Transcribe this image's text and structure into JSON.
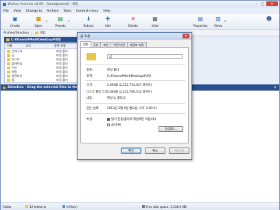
{
  "window": {
    "title": "WinAce Archiver v2.69 - [Unregistered] - 바탕"
  },
  "menu": [
    "File",
    "View",
    "Change to",
    "Archive",
    "Tools",
    "Context menu",
    "Help"
  ],
  "toolbar": {
    "create": "Create",
    "open": "Open",
    "presets": "Presets",
    "extract": "Extract",
    "add": "Add",
    "delete": "Delete",
    "view": "View",
    "properties": "Properties",
    "views": "Views"
  },
  "tabs": {
    "archive_directory": "Archive/Directory",
    "current": "바탕"
  },
  "path": "C:#Users#Mel#Desktop#바탕",
  "left_columns": {
    "name": "이름",
    "size": "크기",
    "type": "항목 유형"
  },
  "left_files": [
    {
      "name": "갓게구리",
      "size": "",
      "type": "파일 폴더"
    },
    {
      "name": "곰",
      "size": "",
      "type": "파일 폴더"
    },
    {
      "name": "마그다",
      "size": "",
      "type": "파일 폴더"
    },
    {
      "name": "플래티넘",
      "size": "",
      "type": "파일 폴더"
    },
    {
      "name": "이브",
      "size": "",
      "type": "파일 폴더"
    },
    {
      "name": "바람",
      "size": "",
      "type": "파일 폴더"
    },
    {
      "name": "발렌타인",
      "size": "",
      "type": "파일 폴더"
    },
    {
      "name": "물",
      "size": "",
      "type": "파일 폴더"
    }
  ],
  "selection_bar": "Selection - Drag the selected files to the",
  "status": {
    "panel": "Folder",
    "selection": "12 folder(s)",
    "files": "0 file(s)",
    "disk": "Free disk space: 1,336.6 MB"
  },
  "dialog": {
    "title": "곰 속성",
    "tabs": [
      "일반",
      "공유",
      "보안",
      "이전 버전",
      "사용자 지정"
    ],
    "name_value": "곰",
    "rows": [
      {
        "label": "종류:",
        "value": "파일 폴더"
      },
      {
        "label": "위치:",
        "value": "C:#Users#Mel#Desktop#바탕"
      },
      {
        "label": "크기:",
        "value": "2.06GB (2,222,754,637 바이트)"
      },
      {
        "label": "디스크 할당 크기:",
        "value": "2.06GB (2,222,760,512 바이트)"
      },
      {
        "label": "내용:",
        "value": "파일 4, 폴더 0"
      },
      {
        "label": "만든 날짜:",
        "value": "2013년 2월 4일 월요일, 오후 3:49:51"
      }
    ],
    "attributes_label": "특성:",
    "readonly_label": "읽기 전용(폴더의 파일에만 적용)(R)",
    "hidden_label": "숨김(H)",
    "advanced_label": "고급(D)...",
    "ok_label": "확인",
    "cancel_label": "취소",
    "apply_label": "적용(A)"
  }
}
